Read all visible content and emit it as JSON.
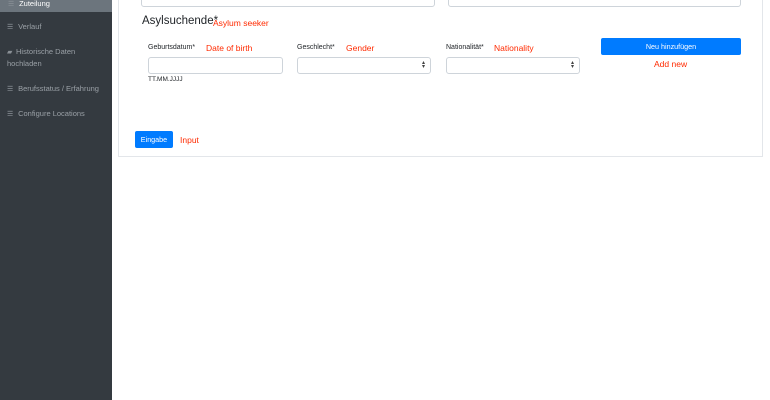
{
  "sidebar": {
    "items": [
      {
        "label": "Zuteilung",
        "icon": "list-icon",
        "active": true
      },
      {
        "label": "Verlauf",
        "icon": "list-icon",
        "active": false
      },
      {
        "label": "Historische Daten hochladen",
        "icon": "upload-icon",
        "active": false
      },
      {
        "label": "Berufsstatus / Erfahrung",
        "icon": "list-icon",
        "active": false
      },
      {
        "label": "Configure Locations",
        "icon": "list-icon",
        "active": false
      }
    ]
  },
  "form": {
    "section_title": "Asylsuchende*",
    "section_annotation": "Asylum seeker",
    "dob": {
      "label": "Geburtsdatum*",
      "annotation": "Date of birth",
      "value": "",
      "hint": "TT.MM.JJJJ"
    },
    "gender": {
      "label": "Geschlecht*",
      "annotation": "Gender",
      "value": ""
    },
    "nationality": {
      "label": "Nationalität*",
      "annotation": "Nationality",
      "value": ""
    },
    "add_button_label": "Neu hinzufügen",
    "add_annotation": "Add new",
    "submit_button_label": "Eingabe",
    "submit_annotation": "Input"
  },
  "colors": {
    "sidebar_bg": "#343a40",
    "sidebar_active_bg": "#6c757d",
    "primary": "#007bff",
    "annotation": "#ff2a00"
  }
}
